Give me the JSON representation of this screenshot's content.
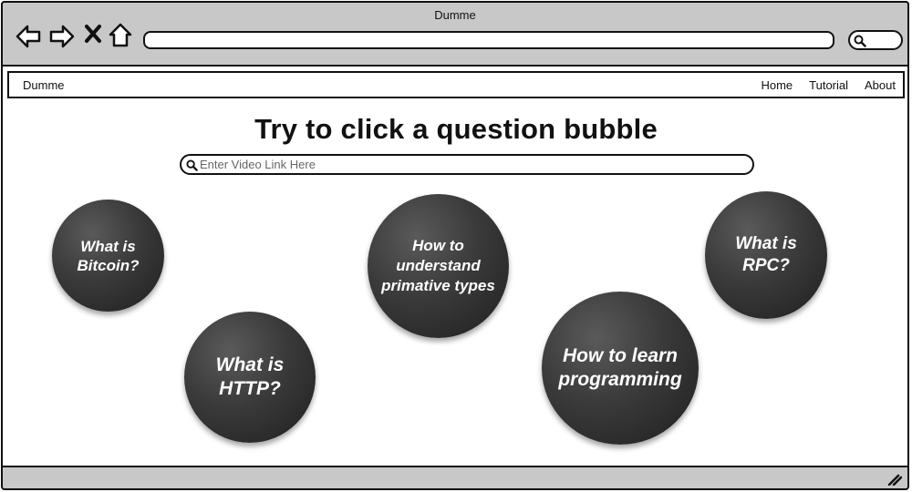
{
  "window": {
    "title": "Dumme"
  },
  "browser": {
    "back_icon": "arrow-left-icon",
    "forward_icon": "arrow-right-icon",
    "stop_icon": "close-icon",
    "home_icon": "home-icon",
    "search_icon": "search-icon"
  },
  "navbar": {
    "brand": "Dumme",
    "links": [
      "Home",
      "Tutorial",
      "About"
    ]
  },
  "main": {
    "heading": "Try to click a question bubble",
    "search": {
      "placeholder": "Enter Video Link Here",
      "value": ""
    },
    "bubbles": [
      {
        "line1": "What is",
        "line2": "Bitcoin?",
        "line3": ""
      },
      {
        "line1": "What is",
        "line2": "HTTP?",
        "line3": ""
      },
      {
        "line1": "How to",
        "line2": "understand",
        "line3": "primative types"
      },
      {
        "line1": "How to learn",
        "line2": "programming",
        "line3": ""
      },
      {
        "line1": "What is",
        "line2": "RPC?",
        "line3": ""
      }
    ]
  },
  "colors": {
    "chrome": "#c8c8c8",
    "bubble": "#333333",
    "bubble_text": "#ffffff"
  }
}
